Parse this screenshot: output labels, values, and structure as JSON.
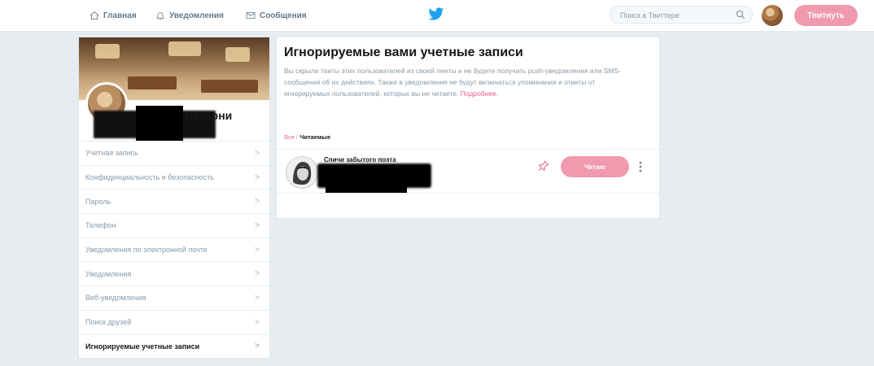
{
  "nav": {
    "home_label": "Главная",
    "notifications_label": "Уведомления",
    "messages_label": "Сообщения"
  },
  "search": {
    "placeholder": "Поиск в Твиттере"
  },
  "tweet_button_label": "Твитнуть",
  "profile": {
    "name": "Пекарни"
  },
  "settings": {
    "items": [
      {
        "label": "Учетная запись"
      },
      {
        "label": "Конфиденциальность и безопасность"
      },
      {
        "label": "Пароль"
      },
      {
        "label": "Телефон"
      },
      {
        "label": "Уведомления по электронной почте"
      },
      {
        "label": "Уведомления"
      },
      {
        "label": "Веб-уведомления"
      },
      {
        "label": "Поиск друзей"
      },
      {
        "label": "Игнорируемые учетные записи"
      }
    ],
    "active_index": 8,
    "chevron": ">"
  },
  "main": {
    "title": "Игнорируемые вами учетные записи",
    "description": "Вы скрыли твиты этих пользователей из своей ленты и не будете получать push-уведомления или SMS-сообщения об их действиях. Также в уведомления не будут включаться упоминания и ответы от игнорируемых пользователей, которых вы не читаете.",
    "learn_more": "Подробнее.",
    "filter_all": "Все",
    "filter_separator": " / ",
    "filter_following": "Читаемые"
  },
  "muted_user": {
    "name": "Спичи забытого поэта",
    "follow_label": "Читаю"
  },
  "colors": {
    "accent_pink": "#f09ab0",
    "link": "#e0245e",
    "twitter_blue": "#1da1f2",
    "background": "#e6ecf0"
  },
  "icons": [
    "home-icon",
    "bell-icon",
    "envelope-icon",
    "twitter-bird-icon",
    "search-icon",
    "pin-icon",
    "more-vertical-icon"
  ]
}
